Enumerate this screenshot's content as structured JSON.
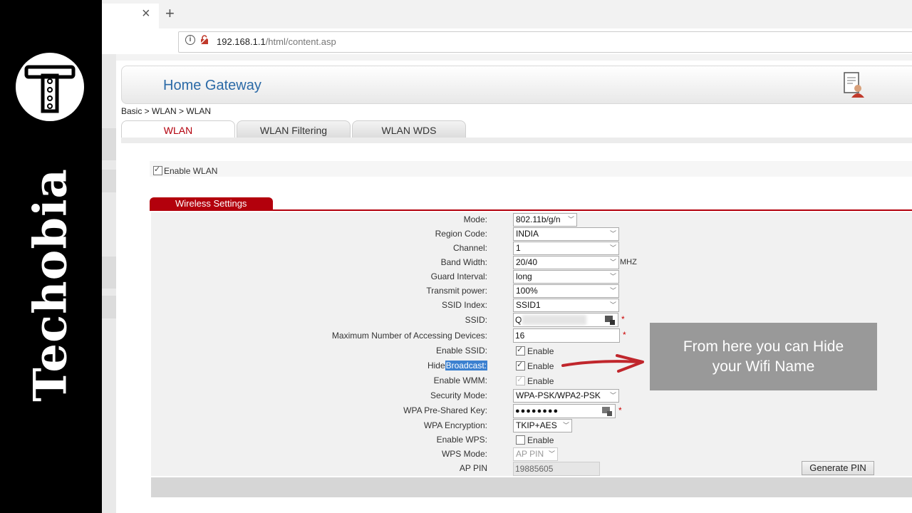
{
  "brand": {
    "name": "Techobia"
  },
  "browser": {
    "tab_close": "×",
    "new_tab": "+",
    "url_host": "192.168.1.1",
    "url_path": "/html/content.asp"
  },
  "header": {
    "title": "Home Gateway"
  },
  "breadcrumb": "Basic > WLAN > WLAN",
  "tabs": [
    "WLAN",
    "WLAN Filtering",
    "WLAN WDS"
  ],
  "enable_wlan_label": "Enable WLAN",
  "section_title": "Wireless Settings",
  "form": {
    "mode": {
      "label": "Mode:",
      "value": "802.11b/g/n"
    },
    "region": {
      "label": "Region Code:",
      "value": "INDIA"
    },
    "channel": {
      "label": "Channel:",
      "value": "1"
    },
    "bandwidth": {
      "label": "Band Width:",
      "value": "20/40",
      "unit": "MHZ"
    },
    "guard": {
      "label": "Guard Interval:",
      "value": "long"
    },
    "power": {
      "label": "Transmit power:",
      "value": "100%"
    },
    "ssid_index": {
      "label": "SSID Index:",
      "value": "SSID1"
    },
    "ssid": {
      "label": "SSID:",
      "value": "Q"
    },
    "max_devices": {
      "label": "Maximum Number of Accessing Devices:",
      "value": "16"
    },
    "enable_ssid": {
      "label": "Enable SSID:",
      "check": "Enable"
    },
    "hide_broadcast": {
      "label_a": "Hide",
      "label_b": "Broadcast:",
      "check": "Enable"
    },
    "enable_wmm": {
      "label": "Enable WMM:",
      "check": "Enable"
    },
    "security": {
      "label": "Security Mode:",
      "value": "WPA-PSK/WPA2-PSK"
    },
    "psk": {
      "label": "WPA Pre-Shared Key:",
      "value": "●●●●●●●●"
    },
    "encryption": {
      "label": "WPA Encryption:",
      "value": "TKIP+AES"
    },
    "enable_wps": {
      "label": "Enable WPS:",
      "check": "Enable"
    },
    "wps_mode": {
      "label": "WPS Mode:",
      "value": "AP PIN"
    },
    "ap_pin": {
      "label": "AP PIN",
      "value": "19885605",
      "button": "Generate PIN"
    },
    "required_mark": "*"
  },
  "callout": {
    "line1": "From here you can Hide",
    "line2": "your Wifi Name"
  },
  "colors": {
    "accent_red": "#b3000c",
    "title_blue": "#2b6aa7",
    "callout_gray": "#999999"
  }
}
